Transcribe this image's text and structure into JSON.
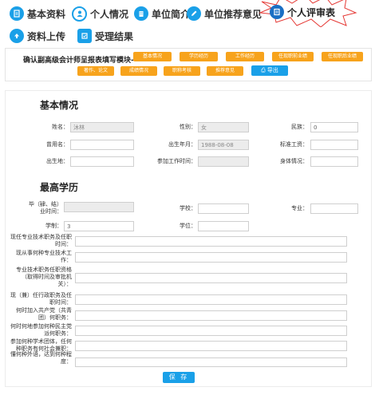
{
  "nav": {
    "items": [
      {
        "label": "基本资料",
        "icon": "document-icon"
      },
      {
        "label": "个人情况",
        "icon": "user-icon"
      },
      {
        "label": "单位简介",
        "icon": "building-icon"
      },
      {
        "label": "单位推荐意见",
        "icon": "edit-icon"
      },
      {
        "label": "个人评审表",
        "icon": "form-icon"
      },
      {
        "label": "资料上传",
        "icon": "upload-icon"
      },
      {
        "label": "受理结果",
        "icon": "result-icon"
      }
    ],
    "active_color": "#e53935",
    "accent": "#1aa0e8"
  },
  "toolbar": {
    "title": "确认副高级会计师呈报表填写模块-",
    "tabs": [
      "基本情况",
      "学历经历",
      "工作经历",
      "任现职前业绩",
      "任现职后业绩",
      "著作、论文",
      "成绩情况",
      "职称考核",
      "推荐意见"
    ],
    "export_label": "导出",
    "button_color": "#f7a31c"
  },
  "basic": {
    "title": "基本情况",
    "name_label": "姓名：",
    "name_value": "沐林",
    "gender_label": "性别：",
    "gender_value": "女",
    "ethnic_label": "民族：",
    "ethnic_value": "0",
    "former_name_label": "曾用名：",
    "birth_label": "出生年月：",
    "birth_value": "1988-08-08",
    "salary_label": "标准工资：",
    "birthplace_label": "出生地：",
    "work_start_label": "参加工作时间：",
    "health_label": "身体情况："
  },
  "edu": {
    "title": "最高学历",
    "grad_time_label": "毕（肄、结）业时间：",
    "school_label": "学校：",
    "major_label": "专业：",
    "duration_label": "学制：",
    "duration_value": "3",
    "degree_label": "学位："
  },
  "wide": [
    "现任专业技术职务及任职时间：",
    "现从事何种专业技术工作：",
    "专业技术职务任职资格（取得时间及审批机关）：",
    "现（兼）任行政职务及任职时间：",
    "何时加入共产党（共青团）何职务：",
    "何时何地参加何种民主党派何职务：",
    "参加何种学术团体，任何种职务有何社会兼职：",
    "懂何种外语，达到何种程度："
  ],
  "save_label": "保 存"
}
